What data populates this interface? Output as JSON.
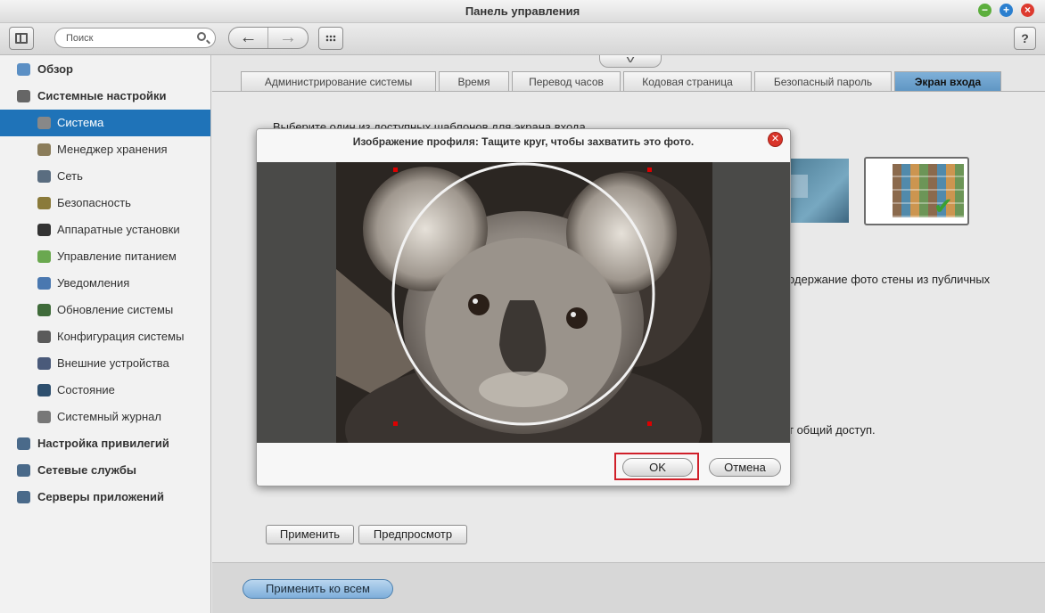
{
  "window": {
    "title": "Панель управления"
  },
  "toolbar": {
    "search_placeholder": "Поиск",
    "help_label": "?"
  },
  "sidebar": {
    "items": [
      {
        "label": "Обзор",
        "level": "top",
        "icon": "overview-icon",
        "color": "#5b8fc4"
      },
      {
        "label": "Системные настройки",
        "level": "top",
        "icon": "system-settings-icon",
        "color": "#666666"
      },
      {
        "label": "Система",
        "level": "sub",
        "icon": "system-icon",
        "color": "#888888",
        "active": true
      },
      {
        "label": "Менеджер хранения",
        "level": "sub",
        "icon": "storage-icon",
        "color": "#8a7c5a"
      },
      {
        "label": "Сеть",
        "level": "sub",
        "icon": "network-icon",
        "color": "#5a6d80"
      },
      {
        "label": "Безопасность",
        "level": "sub",
        "icon": "lock-icon",
        "color": "#8a7a3a"
      },
      {
        "label": "Аппаратные установки",
        "level": "sub",
        "icon": "hardware-icon",
        "color": "#333333"
      },
      {
        "label": "Управление питанием",
        "level": "sub",
        "icon": "power-icon",
        "color": "#6aa84f"
      },
      {
        "label": "Уведомления",
        "level": "sub",
        "icon": "notification-icon",
        "color": "#4a78b0"
      },
      {
        "label": "Обновление системы",
        "level": "sub",
        "icon": "update-icon",
        "color": "#3f6b3a"
      },
      {
        "label": "Конфигурация системы",
        "level": "sub",
        "icon": "config-icon",
        "color": "#5a5a5a"
      },
      {
        "label": "Внешние устройства",
        "level": "sub",
        "icon": "device-icon",
        "color": "#4a5a7a"
      },
      {
        "label": "Состояние",
        "level": "sub",
        "icon": "monitor-icon",
        "color": "#2e4f6e"
      },
      {
        "label": "Системный журнал",
        "level": "sub",
        "icon": "log-icon",
        "color": "#777777"
      },
      {
        "label": "Настройка привилегий",
        "level": "top",
        "icon": "privilege-icon",
        "color": "#4a6a8a"
      },
      {
        "label": "Сетевые службы",
        "level": "top",
        "icon": "network-services-icon",
        "color": "#4a6a8a"
      },
      {
        "label": "Серверы приложений",
        "level": "top",
        "icon": "app-servers-icon",
        "color": "#4a6a8a"
      }
    ]
  },
  "tabs": [
    {
      "label": "Администрирование системы",
      "active": false
    },
    {
      "label": "Время",
      "active": false
    },
    {
      "label": "Перевод часов",
      "active": false
    },
    {
      "label": "Кодовая страница",
      "active": false
    },
    {
      "label": "Безопасный пароль",
      "active": false
    },
    {
      "label": "Экран входа",
      "active": true
    }
  ],
  "content": {
    "template_text": "Выберите один из доступных шаблонов для экрана входа",
    "photo_wall_text": "одержание фото стены из публичных",
    "share_text": "т общий доступ.",
    "apply_label": "Применить",
    "preview_label": "Предпросмотр",
    "apply_all_label": "Применить ко всем"
  },
  "modal": {
    "title": "Изображение профиля: Тащите круг, чтобы захватить это фото.",
    "ok_label": "OK",
    "cancel_label": "Отмена"
  },
  "colors": {
    "accent": "#1f73b8",
    "close_red": "#d9342a",
    "highlight": "#d0202a"
  }
}
